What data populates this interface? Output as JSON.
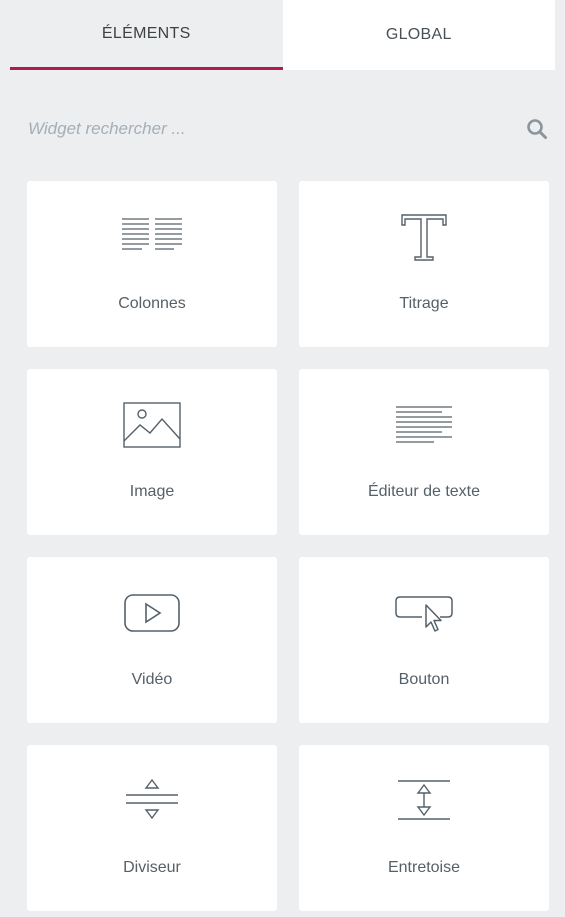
{
  "tabs": [
    {
      "label": "ÉLÉMENTS",
      "active": true
    },
    {
      "label": "GLOBAL",
      "active": false
    }
  ],
  "search": {
    "placeholder": "Widget rechercher ...",
    "value": "",
    "icon": "search-icon"
  },
  "widgets": [
    {
      "label": "Colonnes",
      "icon": "columns-icon"
    },
    {
      "label": "Titrage",
      "icon": "heading-icon"
    },
    {
      "label": "Image",
      "icon": "image-icon"
    },
    {
      "label": "Éditeur de texte",
      "icon": "text-editor-icon"
    },
    {
      "label": "Vidéo",
      "icon": "video-icon"
    },
    {
      "label": "Bouton",
      "icon": "button-icon"
    },
    {
      "label": "Diviseur",
      "icon": "divider-icon"
    },
    {
      "label": "Entretoise",
      "icon": "spacer-icon"
    }
  ],
  "colors": {
    "active_tab_underline": "#b01b4f",
    "panel_background": "#eceef0",
    "card_background": "#ffffff",
    "text": "#556068",
    "placeholder": "#a4afb7",
    "icon_stroke": "#556068"
  }
}
